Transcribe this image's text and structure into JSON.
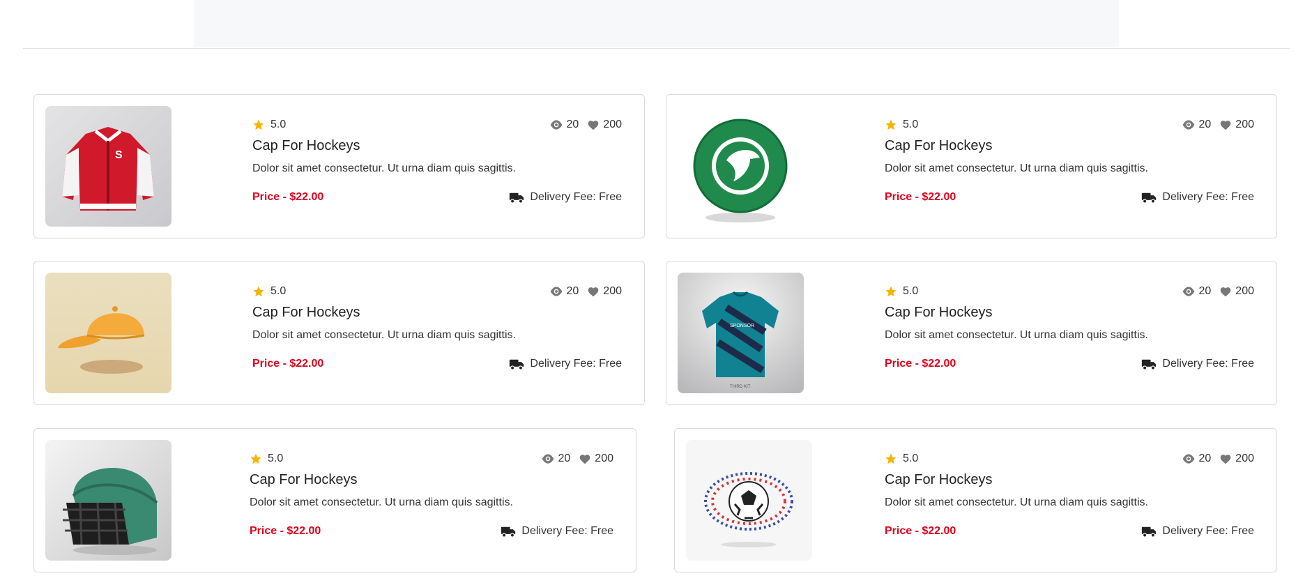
{
  "colors": {
    "price": "#e0001b",
    "star": "#f5b400",
    "stat_icon": "#777777",
    "border": "#d9d9d9"
  },
  "products": [
    {
      "image": "red-varsity-jacket",
      "rating": "5.0",
      "views": "20",
      "likes": "200",
      "title": "Cap For Hockeys",
      "description": "Dolor sit amet consectetur. Ut urna diam quis sagittis.",
      "price": "Price - $22.00",
      "delivery": "Delivery Fee: Free"
    },
    {
      "image": "green-soccer-ball",
      "rating": "5.0",
      "views": "20",
      "likes": "200",
      "title": "Cap For Hockeys",
      "description": "Dolor sit amet consectetur. Ut urna diam quis sagittis.",
      "price": "Price - $22.00",
      "delivery": "Delivery Fee: Free"
    },
    {
      "image": "orange-cap",
      "rating": "5.0",
      "views": "20",
      "likes": "200",
      "title": "Cap For Hockeys",
      "description": "Dolor sit amet consectetur. Ut urna diam quis sagittis.",
      "price": "Price - $22.00",
      "delivery": "Delivery Fee: Free"
    },
    {
      "image": "teal-football-jersey",
      "rating": "5.0",
      "views": "20",
      "likes": "200",
      "title": "Cap For Hockeys",
      "description": "Dolor sit amet consectetur. Ut urna diam quis sagittis.",
      "price": "Price - $22.00",
      "delivery": "Delivery Fee: Free"
    },
    {
      "image": "green-hockey-helmet",
      "rating": "5.0",
      "views": "20",
      "likes": "200",
      "title": "Cap For Hockeys",
      "description": "Dolor sit amet consectetur. Ut urna diam quis sagittis.",
      "price": "Price - $22.00",
      "delivery": "Delivery Fee: Free"
    },
    {
      "image": "soccer-ball-splash",
      "rating": "5.0",
      "views": "20",
      "likes": "200",
      "title": "Cap For Hockeys",
      "description": "Dolor sit amet consectetur. Ut urna diam quis sagittis.",
      "price": "Price - $22.00",
      "delivery": "Delivery Fee: Free"
    }
  ]
}
